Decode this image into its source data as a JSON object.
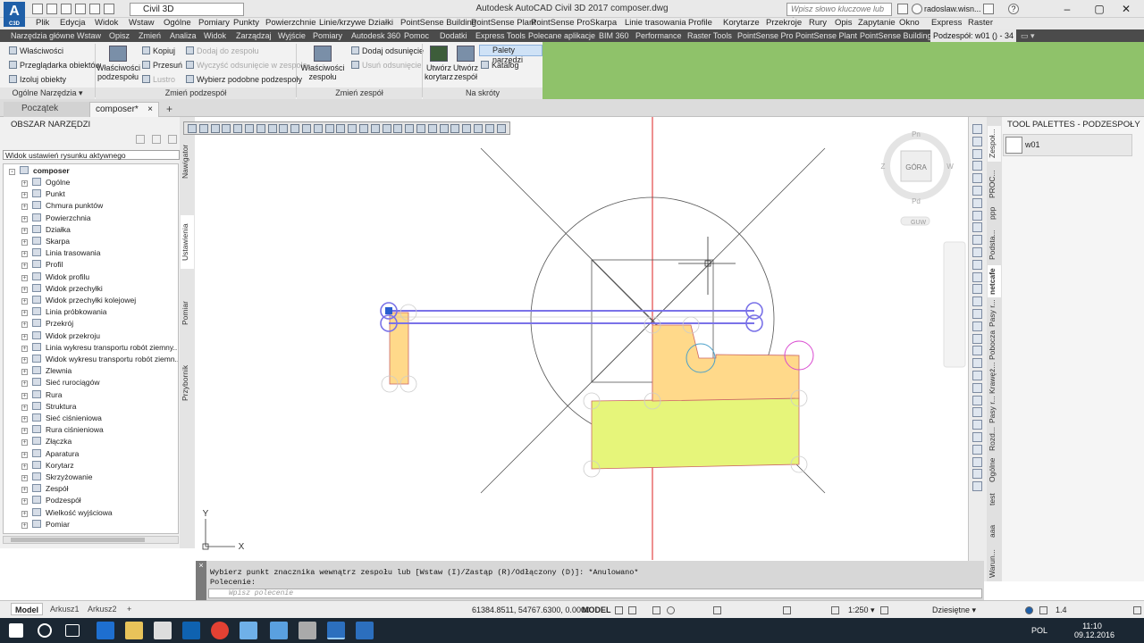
{
  "title_bar": {
    "logo_letter": "A",
    "logo_sub": "C3D",
    "workspace": "Civil 3D",
    "title": "Autodesk AutoCAD Civil 3D 2017    composer.dwg",
    "search_placeholder": "Wpisz słowo kluczowe lub frazę",
    "user": "radoslaw.wisn...",
    "help": "?"
  },
  "menu": [
    "Plik",
    "Edycja",
    "Widok",
    "Wstaw",
    "Ogólne",
    "Pomiary",
    "Punkty",
    "Powierzchnie",
    "Linie/krzywe",
    "Działki",
    "PointSense Building",
    "PointSense Plant",
    "PointSense Pro",
    "Skarpa",
    "Linie trasowania",
    "Profile",
    "Korytarze",
    "Przekroje",
    "Rury",
    "Opis",
    "Zapytanie",
    "Okno",
    "Express",
    "Raster"
  ],
  "ribbon_tabs": [
    "Narzędzia główne",
    "Wstaw",
    "Opisz",
    "Zmień",
    "Analiza",
    "Widok",
    "Zarządzaj",
    "Wyjście",
    "Pomiary",
    "Autodesk 360",
    "Pomoc",
    "Dodatki",
    "Express Tools",
    "Polecane aplikacje",
    "BIM 360",
    "Performance",
    "Raster Tools",
    "PointSense Pro",
    "PointSense Plant",
    "PointSense Building",
    "Podzespół: w01 () - 34"
  ],
  "ribbon": {
    "general": {
      "items": [
        "Właściwości",
        "Przeglądarka obiektów",
        "Izoluj obiekty"
      ],
      "title": "Ogólne Narzędzia ▾"
    },
    "modify_sub": {
      "big_label_1": "Właściwości",
      "big_label_2": "podzespołu",
      "col1": [
        "Kopiuj",
        "Przesuń",
        "Lustro"
      ],
      "col2": [
        "Dodaj do zespołu",
        "Wyczyść odsunięcie w zespole",
        "Wybierz podobne podzespoły"
      ],
      "title": "Zmień podzespół"
    },
    "modify_assembly": {
      "big_label_1": "Właściwości",
      "big_label_2": "zespołu",
      "items": [
        "Dodaj odsunięcie",
        "Usuń odsunięcie"
      ],
      "title": "Zmień zespół"
    },
    "shortcuts": {
      "btn1_l1": "Utwórz",
      "btn1_l2": "korytarz",
      "btn2_l1": "Utwórz",
      "btn2_l2": "zespół",
      "palety": "Palety narzędzi",
      "katalog": "Katalog",
      "title": "Na skróty"
    }
  },
  "doc_tabs": {
    "start": "Początek",
    "composer": "composer*",
    "close": "×",
    "plus": "+"
  },
  "toolspace": {
    "title": "OBSZAR NARZĘDZI",
    "close": "×",
    "combo": "Widok ustawień rysunku aktywnego",
    "root": "composer",
    "items": [
      "Ogólne",
      "Punkt",
      "Chmura punktów",
      "Powierzchnia",
      "Działka",
      "Skarpa",
      "Linia trasowania",
      "Profil",
      "Widok profilu",
      "Widok przechyłki",
      "Widok przechyłki kolejowej",
      "Linia próbkowania",
      "Przekrój",
      "Widok przekroju",
      "Linia wykresu transportu robót ziemny...",
      "Widok wykresu transportu robót ziemn...",
      "Zlewnia",
      "Sieć rurociągów",
      "Rura",
      "Struktura",
      "Sieć ciśnieniowa",
      "Rura ciśnieniowa",
      "Złączka",
      "Aparatura",
      "Korytarz",
      "Skrzyżowanie",
      "Zespół",
      "Podzespół",
      "Wielkość wyjściowa",
      "Pomiar"
    ],
    "vtabs": [
      "Nawigator",
      "Ustawienia",
      "Pomiar",
      "Przybornik"
    ]
  },
  "viewcube": {
    "top": "GÓRA",
    "n": "Pn",
    "s": "Pd",
    "w": "Z",
    "e": "W",
    "ucs": "GUW"
  },
  "ucs_icon": {
    "x": "X",
    "y": "Y"
  },
  "palettes": {
    "title": "TOOL PALETTES - PODZESPOŁY ...",
    "item": "w01",
    "vtabs": [
      "Zespoł...",
      "PROC...",
      "ppp",
      "Podsta...",
      "netcafe",
      "Pasy r...",
      "Pobocza",
      "Krawęż...",
      "Pasy r...",
      "Rozd...",
      "Ogólne",
      "test",
      "aaa",
      "Warun..."
    ]
  },
  "command": {
    "history1": "Wybierz punkt znacznika wewnątrz zespołu lub [Wstaw (I)/Zastąp (R)/Odłączony (D)]: *Anulowano*",
    "history2": "Polecenie:",
    "placeholder": "Wpisz polecenie"
  },
  "status": {
    "tabs": [
      "Model",
      "Arkusz1",
      "Arkusz2",
      "+"
    ],
    "coords": "61384.8511, 54767.6300, 0.0000",
    "model": "MODEL",
    "scale": "1:250 ▾",
    "units": "Dziesiętne ▾",
    "zoom": "1.4"
  },
  "taskbar": {
    "lang": "POL",
    "time": "11:10",
    "date": "09.12.2016"
  },
  "colors": {
    "ribbon_dark": "#4b4b4b",
    "ribbon_green": "#8fc26a",
    "shape_orange": "#ffd98a",
    "shape_green": "#e6f57a",
    "grip_blue": "#7a72e8",
    "grip_magenta": "#d94ad0",
    "axis_red": "#d22"
  }
}
